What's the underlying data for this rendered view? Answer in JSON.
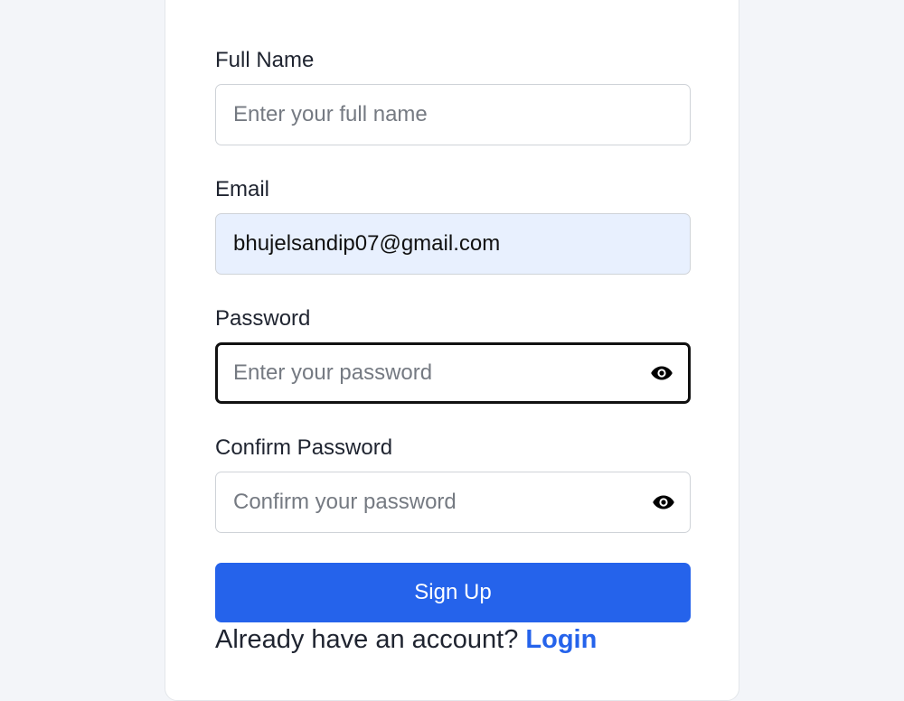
{
  "form": {
    "full_name": {
      "label": "Full Name",
      "placeholder": "Enter your full name",
      "value": ""
    },
    "email": {
      "label": "Email",
      "placeholder": "",
      "value": "bhujelsandip07@gmail.com"
    },
    "password": {
      "label": "Password",
      "placeholder": "Enter your password",
      "value": ""
    },
    "confirm_password": {
      "label": "Confirm Password",
      "placeholder": "Confirm your password",
      "value": ""
    },
    "submit_label": "Sign Up",
    "footer_text": "Already have an account?",
    "login_link": "Login"
  },
  "icons": {
    "password_toggle": "eye-icon",
    "confirm_password_toggle": "eye-icon"
  },
  "colors": {
    "primary": "#2563eb",
    "autofill_background": "#e8f0fe",
    "focus_border": "#111111"
  }
}
